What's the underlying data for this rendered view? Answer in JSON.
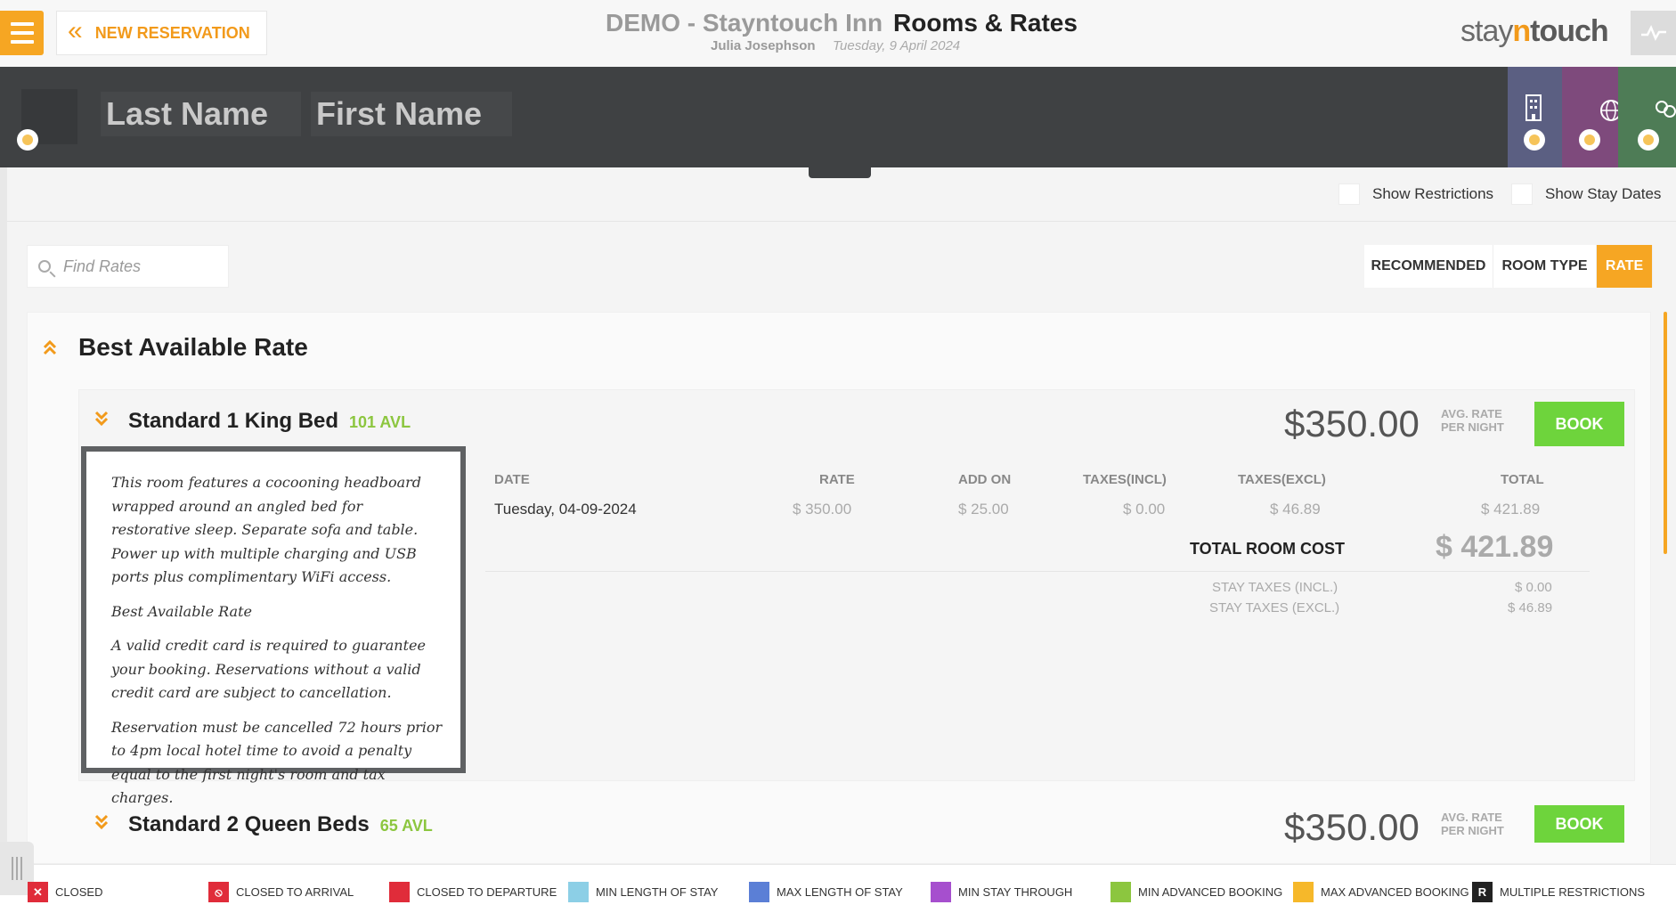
{
  "header": {
    "new_reservation_label": "NEW RESERVATION",
    "hotel_name": "DEMO - Stayntouch Inn",
    "page_title": "Rooms & Rates",
    "user_name": "Julia Josephson",
    "business_date": "Tuesday, 9 April 2024",
    "logo": {
      "part1": "stay",
      "part2": "n",
      "part3": "touch"
    }
  },
  "search": {
    "last_name_placeholder": "Last Name",
    "first_name_placeholder": "First Name"
  },
  "options": {
    "show_restrictions": "Show Restrictions",
    "show_stay_dates": "Show Stay Dates"
  },
  "find_rates": {
    "placeholder": "Find Rates"
  },
  "view_tabs": [
    {
      "label": "RECOMMENDED",
      "active": false
    },
    {
      "label": "ROOM TYPE",
      "active": false
    },
    {
      "label": "RATE",
      "active": true
    }
  ],
  "rate_group": {
    "title": "Best Available Rate",
    "rooms": [
      {
        "name": "Standard 1 King Bed",
        "availability": "101 AVL",
        "price": "$350.00",
        "avg_label_1": "AVG. RATE",
        "avg_label_2": "PER NIGHT",
        "book_label": "BOOK",
        "description": [
          "This room features a cocooning headboard wrapped around an angled bed for restorative sleep. Separate sofa and table. Power up with multiple charging and USB ports plus complimentary WiFi access.",
          "Best Available Rate",
          "A valid credit card is required to guarantee your booking. Reservations without a valid credit card are subject to cancellation.",
          "Reservation must be cancelled 72 hours prior to 4pm local hotel time to avoid a penalty equal to the first night's room and tax charges."
        ],
        "table": {
          "headers": {
            "date": "DATE",
            "rate": "RATE",
            "addon": "ADD ON",
            "taxes_incl": "TAXES(INCL)",
            "taxes_excl": "TAXES(EXCL)",
            "total": "TOTAL"
          },
          "row": {
            "date": "Tuesday, 04-09-2024",
            "rate": "$ 350.00",
            "addon": "$ 25.00",
            "taxes_incl": "$ 0.00",
            "taxes_excl": "$ 46.89",
            "total": "$ 421.89"
          },
          "total_room_cost_label": "TOTAL ROOM COST",
          "total_room_cost": "$ 421.89",
          "stay_taxes_incl_label": "STAY TAXES (INCL.)",
          "stay_taxes_incl": "$ 0.00",
          "stay_taxes_excl_label": "STAY TAXES (EXCL.)",
          "stay_taxes_excl": "$ 46.89"
        }
      },
      {
        "name": "Standard 2 Queen Beds",
        "availability": "65 AVL",
        "price": "$350.00",
        "avg_label_1": "AVG. RATE",
        "avg_label_2": "PER NIGHT",
        "book_label": "BOOK"
      }
    ]
  },
  "legend": [
    {
      "label": "CLOSED",
      "color": "#e02c3a",
      "glyph": "✕"
    },
    {
      "label": "CLOSED TO ARRIVAL",
      "color": "#e02c3a",
      "glyph": "⦸"
    },
    {
      "label": "CLOSED TO DEPARTURE",
      "color": "#e02c3a",
      "glyph": ""
    },
    {
      "label": "MIN LENGTH OF STAY",
      "color": "#8ccfe6",
      "glyph": ""
    },
    {
      "label": "MAX LENGTH OF STAY",
      "color": "#5b7fd6",
      "glyph": ""
    },
    {
      "label": "MIN STAY THROUGH",
      "color": "#a64fce",
      "glyph": ""
    },
    {
      "label": "MIN ADVANCED BOOKING",
      "color": "#8cc63f",
      "glyph": ""
    },
    {
      "label": "MAX ADVANCED BOOKING",
      "color": "#f6b82a",
      "glyph": ""
    },
    {
      "label": "MULTIPLE RESTRICTIONS",
      "color": "#222222",
      "glyph": "R"
    }
  ],
  "colors": {
    "accent": "#f6a623",
    "book": "#6ed43c",
    "avl": "#8cc63f",
    "dark": "#3f4143"
  }
}
